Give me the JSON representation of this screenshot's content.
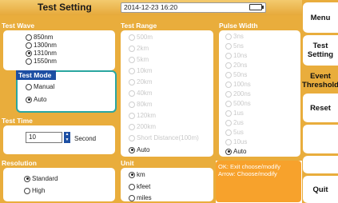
{
  "header": {
    "title": "Test Setting",
    "datetime": "2014-12-23 16:20"
  },
  "sections": {
    "test_wave": {
      "title": "Test Wave",
      "options": [
        {
          "label": "850nm",
          "selected": false
        },
        {
          "label": "1300nm",
          "selected": false
        },
        {
          "label": "1310nm",
          "selected": true
        },
        {
          "label": "1550nm",
          "selected": false
        }
      ]
    },
    "test_mode": {
      "title": "Test Mode",
      "options": [
        {
          "label": "Manual",
          "selected": false
        },
        {
          "label": "Auto",
          "selected": true
        }
      ]
    },
    "test_time": {
      "title": "Test Time",
      "value": "10",
      "unit": "Second"
    },
    "resolution": {
      "title": "Resolution",
      "options": [
        {
          "label": "Standard",
          "selected": true
        },
        {
          "label": "High",
          "selected": false
        }
      ]
    },
    "test_range": {
      "title": "Test Range",
      "options": [
        {
          "label": "500m",
          "selected": false,
          "disabled": true
        },
        {
          "label": "2km",
          "selected": false,
          "disabled": true
        },
        {
          "label": "5km",
          "selected": false,
          "disabled": true
        },
        {
          "label": "10km",
          "selected": false,
          "disabled": true
        },
        {
          "label": "20km",
          "selected": false,
          "disabled": true
        },
        {
          "label": "40km",
          "selected": false,
          "disabled": true
        },
        {
          "label": "80km",
          "selected": false,
          "disabled": true
        },
        {
          "label": "120km",
          "selected": false,
          "disabled": true
        },
        {
          "label": "200km",
          "selected": false,
          "disabled": true
        },
        {
          "label": "Short Distance(100m)",
          "selected": false,
          "disabled": true
        },
        {
          "label": "Auto",
          "selected": true,
          "disabled": false
        }
      ]
    },
    "unit": {
      "title": "Unit",
      "options": [
        {
          "label": "km",
          "selected": true
        },
        {
          "label": "kfeet",
          "selected": false
        },
        {
          "label": "miles",
          "selected": false
        }
      ]
    },
    "pulse_width": {
      "title": "Pulse Width",
      "options": [
        {
          "label": "3ns",
          "selected": false,
          "disabled": true
        },
        {
          "label": "5ns",
          "selected": false,
          "disabled": true
        },
        {
          "label": "10ns",
          "selected": false,
          "disabled": true
        },
        {
          "label": "20ns",
          "selected": false,
          "disabled": true
        },
        {
          "label": "50ns",
          "selected": false,
          "disabled": true
        },
        {
          "label": "100ns",
          "selected": false,
          "disabled": true
        },
        {
          "label": "200ns",
          "selected": false,
          "disabled": true
        },
        {
          "label": "500ns",
          "selected": false,
          "disabled": true
        },
        {
          "label": "1us",
          "selected": false,
          "disabled": true
        },
        {
          "label": "2us",
          "selected": false,
          "disabled": true
        },
        {
          "label": "5us",
          "selected": false,
          "disabled": true
        },
        {
          "label": "10us",
          "selected": false,
          "disabled": true
        },
        {
          "label": "Auto",
          "selected": true,
          "disabled": false
        }
      ]
    }
  },
  "help": {
    "line1": "OK: Exit choose/modify",
    "line2": "Arrow: Choose/modify"
  },
  "sidebar": {
    "menu": "Menu",
    "test_setting": "Test Setting",
    "event_threshold": "Event Threshold",
    "reset": "Reset",
    "quit": "Quit"
  },
  "icons": {
    "battery": "battery-icon",
    "stepper": "stepper-icon"
  },
  "colors": {
    "panel": "#e9ad3c",
    "active_border": "#2aa6a0",
    "help_box": "#f7a22c",
    "stepper": "#1d4fa3"
  }
}
